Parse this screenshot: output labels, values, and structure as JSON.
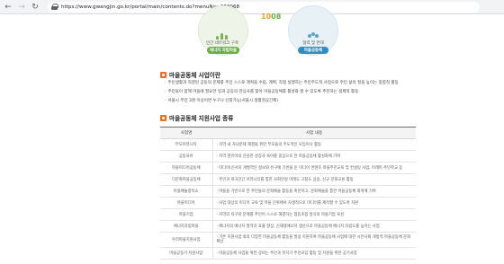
{
  "browser": {
    "url": "https://www.gwangjin.go.kr/portal/main/contents.do?menuNo=200068",
    "back_icon": "←",
    "forward_icon": "→",
    "reload_icon": "↻"
  },
  "hero": {
    "number_orange": "10",
    "number_green": "08",
    "left_caption": "민간 네트워크 구축",
    "right_caption": "협력 및 연대",
    "left_pill": "에너지 자립마을",
    "right_pill": "마을공동체"
  },
  "section1": {
    "title": "마을공동체 사업이란",
    "bullets": [
      "주민생활과 직결된 공동의 문제를 주민 스스로 계획을 수립, 계획, 직접 실행하는 주민주도적 사업으로 주민 삶의 질을 높이는 종합적 활동",
      "주민들이 함께 마을에 필요한 일과 공동의 관심사를 찾아 마을공동체를 활성화 할 수 있도록 추진하는 실제적 활동",
      "서울시 주민 3명 이상이면 누구나 신청가능(서울시 생활권공간제)"
    ]
  },
  "section2": {
    "title": "마을공동체 지원사업 종류",
    "headers": [
      "사업명",
      "사업 내용"
    ],
    "rows": [
      {
        "name": "부모커뮤니티",
        "desc": [
          "지역 내 자녀문제 해결을 위한 부모들의 주도적인 모임이나 활동"
        ]
      },
      {
        "name": "공동육아",
        "desc": [
          "지역 영유아의 건강한 성장과 육아를 중심으로 한 마을공동체 활성화에 기여"
        ]
      },
      {
        "name": "마을미디어공동체",
        "desc": [
          "미디어(신서지 개발역인 정보와 유구에 기반을 둔 미디어 콘텐츠 마을주민교육 및 컨설팅 사업, 미래미 주민학교 등"
        ]
      },
      {
        "name": "다문화마을공동체",
        "desc": [
          "주민과 외국인간 커뮤니티를 통한 사회안정 미래도 고찰도 상승, 신규 문화교류 활동"
        ]
      },
      {
        "name": "마을예술창작소",
        "desc": [
          "마을을 기반으로 한 주민들의 문화예술 활동을 촉진하고, 문화예술을 통한 마을공동체 회복에 기여"
        ]
      },
      {
        "name": "마을미디어",
        "desc": [
          "사업 대상의 미디어 교육 및 마을 단위에서 자생적으로 미디어를 제작할 수 있도록 지원"
        ]
      },
      {
        "name": "마을기업",
        "desc": [
          "지역의 욕구와 문제를 주민이 스스로 해결하는 협동조합 방식의 마을기업 육성"
        ]
      },
      {
        "name": "에너지자립마을",
        "desc": [
          "에너지의 에너지 절약과 효율 향상, 신재생에너지 생산으로 마을공동체 에너지 자립도를 높이는 사업"
        ]
      },
      {
        "name": "우리마을지원사업",
        "desc": [
          "기존 지원사업 외의 다양한 마을공동체 활동을 발굴 지원하여 마을공동체 사업에 대한 시민사회 개방적 마을공동체 문화 확산"
        ]
      },
      {
        "name": "마을공동기 지원사업",
        "desc": [
          "마을공동체 사업을 위한 장비는 주민과 복지기 주민모임 활동 및 지원을 위한 공기사업"
        ]
      }
    ]
  }
}
